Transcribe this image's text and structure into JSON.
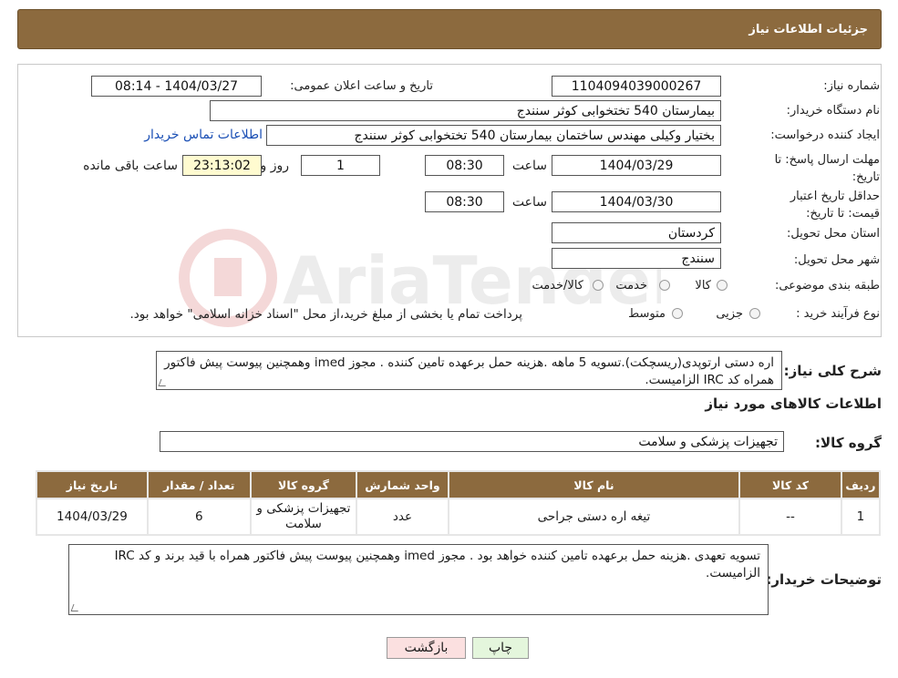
{
  "header": {
    "title": "جزئیات اطلاعات نیاز"
  },
  "form": {
    "need_number_label": "شماره نیاز:",
    "need_number": "1104094039000267",
    "announce_label": "تاریخ و ساعت اعلان عمومی:",
    "announce_value": "1404/03/27 - 08:14",
    "buyer_org_label": "نام دستگاه خریدار:",
    "buyer_org": "بیمارستان 540 تختخوابی کوثر سنندج",
    "creator_label": "ایجاد کننده درخواست:",
    "creator": "بختیار وکیلی مهندس ساختمان بیمارستان 540 تختخوابی کوثر سنندج",
    "contact_link": "اطلاعات تماس خریدار",
    "deadline_label": "مهلت ارسال پاسخ: تا تاریخ:",
    "deadline_date": "1404/03/29",
    "time_label": "ساعت",
    "deadline_time": "08:30",
    "days_value": "1",
    "days_label": "روز و",
    "remaining_time": "23:13:02",
    "remaining_label": "ساعت باقی مانده",
    "validity_label": "حداقل تاریخ اعتبار قیمت: تا تاریخ:",
    "validity_date": "1404/03/30",
    "validity_time": "08:30",
    "province_label": "استان محل تحویل:",
    "province": "کردستان",
    "city_label": "شهر محل تحویل:",
    "city": "سنندج",
    "category_label": "طبقه بندی موضوعی:",
    "category_options": [
      "کالا",
      "خدمت",
      "کالا/خدمت"
    ],
    "process_label": "نوع فرآیند خرید :",
    "process_options": [
      "جزیی",
      "متوسط"
    ],
    "process_note": "پرداخت تمام یا بخشی از مبلغ خرید،از محل \"اسناد خزانه اسلامی\" خواهد بود."
  },
  "summary": {
    "label": "شرح کلی نیاز:",
    "text": "اره دستی ارتوپدی(ریسچکت).تسویه 5 ماهه .هزینه حمل برعهده تامین کننده . مجوز imed وهمچنین پیوست پیش فاکتور همراه کد IRC  الزامیست."
  },
  "goods_section_title": "اطلاعات کالاهای مورد نیاز",
  "goods_group": {
    "label": "گروه کالا:",
    "value": "تجهیزات پزشکی و سلامت"
  },
  "table": {
    "headers": [
      "ردیف",
      "کد کالا",
      "نام کالا",
      "واحد شمارش",
      "گروه کالا",
      "تعداد / مقدار",
      "تاریخ نیاز"
    ],
    "rows": [
      [
        "1",
        "--",
        "تیغه اره دستی جراحی",
        "عدد",
        "تجهیزات پزشکی و سلامت",
        "6",
        "1404/03/29"
      ]
    ]
  },
  "buyer_notes": {
    "label": "توضیحات خریدار:",
    "text": "تسویه تعهدی .هزینه حمل برعهده تامین کننده خواهد بود . مجوز imed وهمچنین پیوست پیش فاکتور همراه  با قید برند و کد IRC  الزامیست."
  },
  "buttons": {
    "print": "چاپ",
    "back": "بازگشت"
  },
  "colors": {
    "header_bg": "#8c6a3e",
    "link": "#1a4fb5",
    "time_box": "#fffbd0",
    "print_btn": "#e4f6dc",
    "back_btn": "#fbe0e0"
  }
}
